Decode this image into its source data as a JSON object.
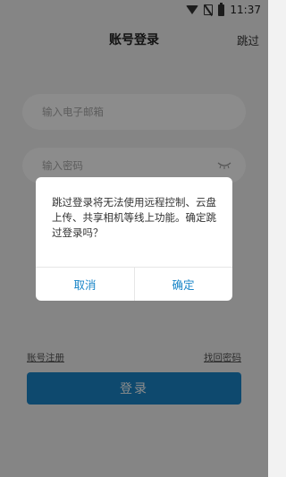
{
  "status_bar": {
    "time": "11:37",
    "icons": [
      "wifi-icon",
      "no-sim-icon",
      "battery-icon"
    ]
  },
  "header": {
    "title": "账号登录",
    "skip_label": "跳过"
  },
  "form": {
    "email_placeholder": "输入电子邮箱",
    "password_placeholder": "输入密码",
    "register_label": "账号注册",
    "forgot_label": "找回密码",
    "login_label": "登录"
  },
  "dialog": {
    "message": "跳过登录将无法使用远程控制、云盘上传、共享相机等线上功能。确定跳过登录吗？",
    "cancel_label": "取消",
    "confirm_label": "确定"
  },
  "colors": {
    "accent": "#1a86c8",
    "background": "#f2f2f2",
    "overlay": "rgba(0,0,0,0.45)"
  }
}
